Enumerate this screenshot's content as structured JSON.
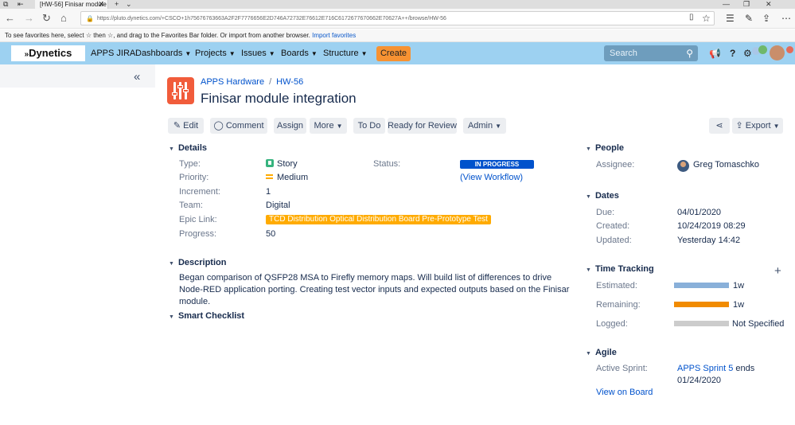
{
  "browser": {
    "tab_title": "[HW-56] Finisar module",
    "url": "https://pluto.dynetics.com/+CSCO+1h75676763663A2F2F7776656E2D746A72732E76612E716C6172677670662E70627A++/browse/HW-56",
    "favbar_text": "To see favorites here, select  ☆  then ☆, and drag to the Favorites Bar folder. Or import from another browser.",
    "favbar_link": "Import favorites"
  },
  "nav": {
    "logo": "Dynetics",
    "app": "APPS JIRA",
    "menus": [
      "Dashboards",
      "Projects",
      "Issues",
      "Boards",
      "Structure"
    ],
    "create": "Create",
    "search_placeholder": "Search"
  },
  "issue": {
    "project": "APPS Hardware",
    "key": "HW-56",
    "title": "Finisar module integration"
  },
  "toolbar": {
    "edit": "Edit",
    "comment": "Comment",
    "assign": "Assign",
    "more": "More",
    "todo": "To Do",
    "ready": "Ready for Review",
    "admin": "Admin",
    "export": "Export"
  },
  "details": {
    "title": "Details",
    "type_label": "Type:",
    "type_value": "Story",
    "priority_label": "Priority:",
    "priority_value": "Medium",
    "increment_label": "Increment:",
    "increment_value": "1",
    "team_label": "Team:",
    "team_value": "Digital",
    "epic_label": "Epic Link:",
    "epic_value": "TCD Distribution Optical Distribution Board Pre-Prototype Test",
    "progress_label": "Progress:",
    "progress_value": "50",
    "status_label": "Status:",
    "status_value": "IN PROGRESS",
    "workflow_link": "View Workflow"
  },
  "description": {
    "title": "Description",
    "text": "Began comparison of QSFP28 MSA to Firefly memory maps.  Will build list of differences to drive Node-RED application porting.  Creating test vector inputs and expected outputs based on the Finisar module."
  },
  "smart_checklist": {
    "title": "Smart Checklist"
  },
  "people": {
    "title": "People",
    "assignee_label": "Assignee:",
    "assignee": "Greg Tomaschko"
  },
  "dates": {
    "title": "Dates",
    "due_label": "Due:",
    "due": "04/01/2020",
    "created_label": "Created:",
    "created": "10/24/2019 08:29",
    "updated_label": "Updated:",
    "updated": "Yesterday 14:42"
  },
  "time_tracking": {
    "title": "Time Tracking",
    "estimated_label": "Estimated:",
    "estimated": "1w",
    "remaining_label": "Remaining:",
    "remaining": "1w",
    "logged_label": "Logged:",
    "logged": "Not Specified",
    "colors": {
      "estimated": "#89b0d9",
      "remaining": "#f18b00",
      "logged": "#cccccc"
    }
  },
  "agile": {
    "title": "Agile",
    "active_sprint_label": "Active Sprint:",
    "sprint_name": "APPS Sprint 5",
    "sprint_ends": "ends",
    "sprint_end_date": "01/24/2020",
    "view_board": "View on Board"
  }
}
